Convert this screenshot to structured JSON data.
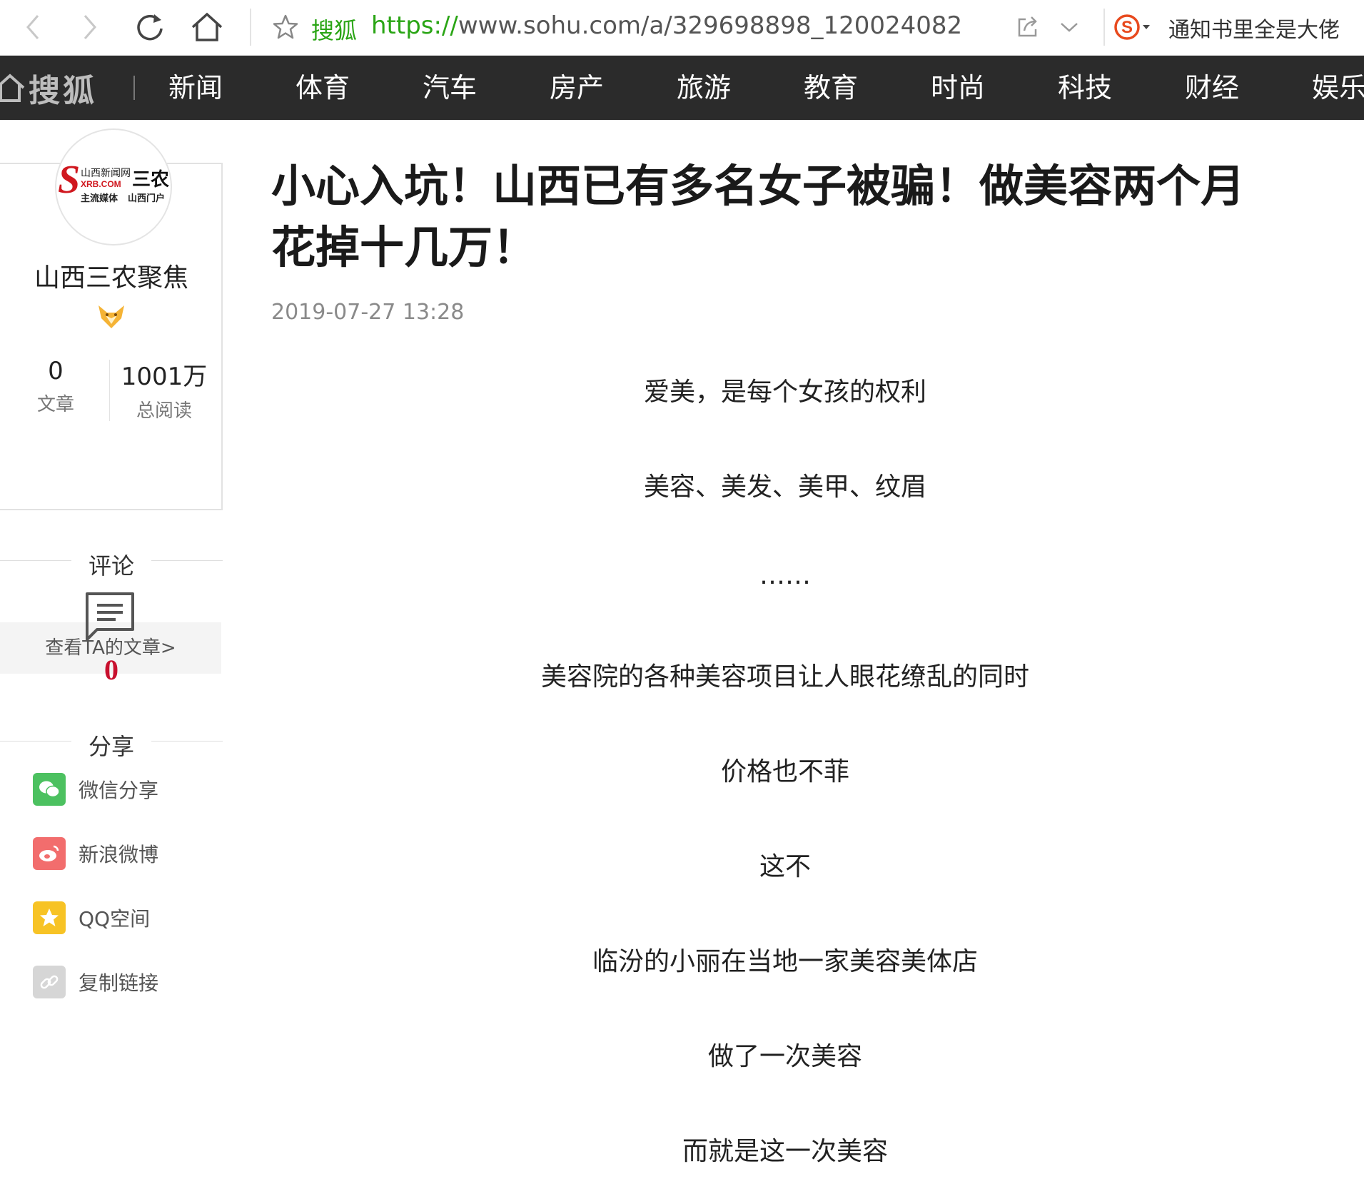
{
  "browser": {
    "site_name": "搜狐",
    "url_protocol": "https://",
    "url_rest": "www.sohu.com/a/329698898_120024082",
    "user_text": "通知书里全是大佬"
  },
  "nav": {
    "logo": "搜狐",
    "items": [
      "新闻",
      "体育",
      "汽车",
      "房产",
      "旅游",
      "教育",
      "时尚",
      "科技",
      "财经",
      "娱乐"
    ]
  },
  "author": {
    "name": "山西三农聚焦",
    "logo_lines": [
      "山西新闻网",
      "XRB.COM",
      "主流媒体",
      "山西门户",
      "三农"
    ],
    "articles_count": "0",
    "articles_label": "文章",
    "reads_count": "1001万",
    "reads_label": "总阅读",
    "view_articles_link": "查看TA的文章>"
  },
  "comments": {
    "title": "评论",
    "count": "0"
  },
  "share": {
    "title": "分享",
    "items": [
      {
        "label": "微信分享",
        "icon": "wechat-icon",
        "color": "#4cc160"
      },
      {
        "label": "新浪微博",
        "icon": "weibo-icon",
        "color": "#f26d6d"
      },
      {
        "label": "QQ空间",
        "icon": "qzone-icon",
        "color": "#f7c325"
      },
      {
        "label": "复制链接",
        "icon": "link-icon",
        "color": "#d6d6d6"
      }
    ]
  },
  "article": {
    "title_line1": "小心入坑！山西已有多名女子被骗！做美容两个月",
    "title_line2": "花掉十几万！",
    "time": "2019-07-27 13:28",
    "paragraphs": [
      "爱美，是每个女孩的权利",
      "美容、美发、美甲、纹眉",
      "……",
      "美容院的各种美容项目让人眼花缭乱的同时",
      "价格也不菲",
      "这不",
      "临汾的小丽在当地一家美容美体店",
      "做了一次美容",
      "而就是这一次美容"
    ]
  },
  "colors": {
    "nav_bg": "#2b2b2b",
    "url_green": "#2aa515",
    "comment_red": "#c8102e"
  }
}
